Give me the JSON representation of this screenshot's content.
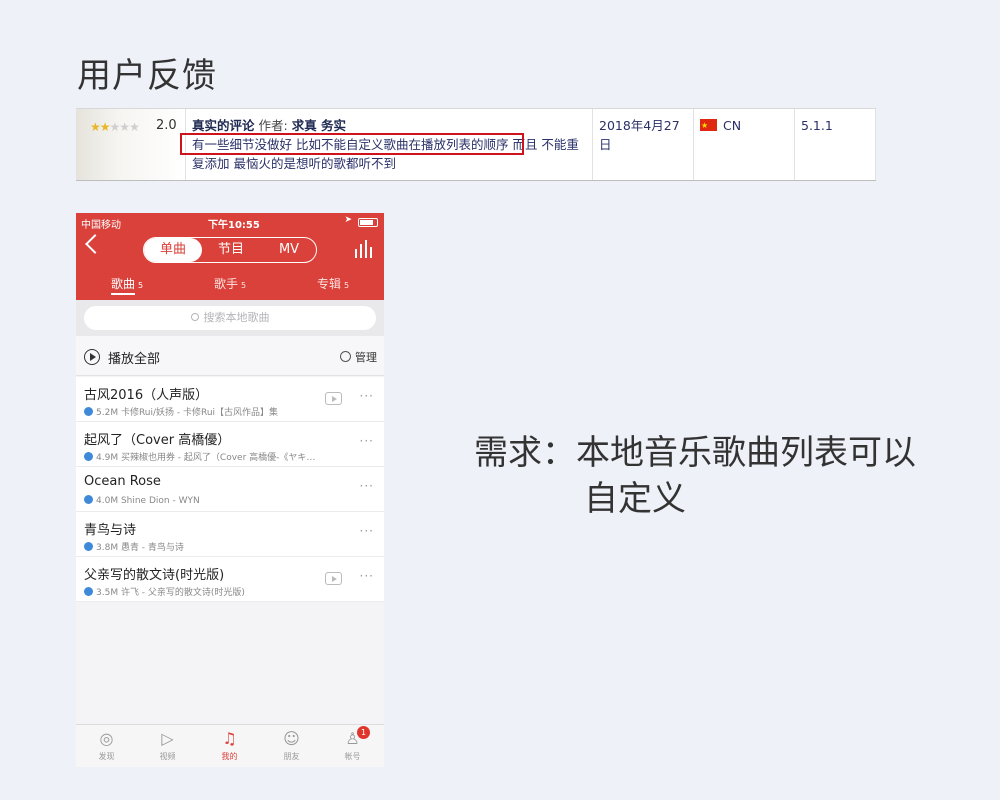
{
  "page_title": "用户反馈",
  "review": {
    "stars_filled": 2,
    "stars_total": 5,
    "rating": "2.0",
    "title": "真实的评论",
    "author_label": "作者:",
    "author": "求真 务实",
    "body_highlight": "有一些细节没做好 比如不能自定义歌曲在播放列表的顺序",
    "body_rest": " 而且 不能重复添加 最恼火的是想听的歌都听不到",
    "date": "2018年4月27日",
    "country": "CN",
    "version": "5.1.1"
  },
  "phone": {
    "status": {
      "carrier": "中国移动",
      "time": "下午10:55"
    },
    "segments": [
      "单曲",
      "节目",
      "MV"
    ],
    "subtabs": [
      {
        "label": "歌曲",
        "count": "5"
      },
      {
        "label": "歌手",
        "count": "5"
      },
      {
        "label": "专辑",
        "count": "5"
      }
    ],
    "search_placeholder": "搜索本地歌曲",
    "play_all": "播放全部",
    "manage": "管理",
    "songs": [
      {
        "title": "古风2016（人声版）",
        "meta": "5.2M 卡修Rui/妖扬 - 卡修Rui【古风作品】集",
        "mv": true
      },
      {
        "title": "起风了（Cover 高橋優）",
        "meta": "4.9M 买辣椒也用券 - 起风了（Cover 高橋優-《ヤキ…",
        "mv": false
      },
      {
        "title": "Ocean Rose",
        "meta": "4.0M Shine Dion - WYN",
        "mv": false
      },
      {
        "title": "青鸟与诗",
        "meta": "3.8M 愚青 - 青鸟与诗",
        "mv": false
      },
      {
        "title": "父亲写的散文诗(时光版)",
        "meta": "3.5M 许飞 - 父亲写的散文诗(时光版)",
        "mv": true
      }
    ],
    "tabs": [
      {
        "label": "发现",
        "icon": "discover-icon"
      },
      {
        "label": "视频",
        "icon": "video-icon"
      },
      {
        "label": "我的",
        "icon": "music-note-icon"
      },
      {
        "label": "朋友",
        "icon": "friends-icon"
      },
      {
        "label": "帐号",
        "icon": "account-icon",
        "badge": "1"
      }
    ]
  },
  "requirement": {
    "line1": "需求：本地音乐歌曲列表可以",
    "line2": "自定义"
  },
  "colors": {
    "accent": "#d9413a",
    "highlight_border": "#d0121c",
    "verified": "#3e8ad9"
  }
}
